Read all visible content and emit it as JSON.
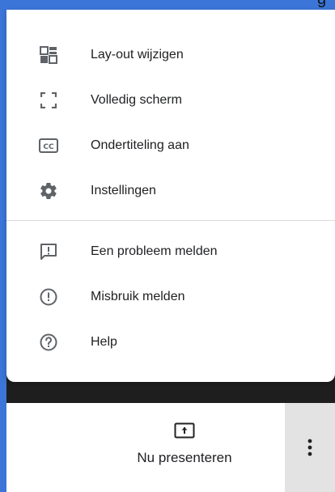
{
  "header": {
    "title_fragment": "g"
  },
  "menu": {
    "items": [
      {
        "label": "Lay-out wijzigen",
        "icon": "layout-icon"
      },
      {
        "label": "Volledig scherm",
        "icon": "fullscreen-icon"
      },
      {
        "label": "Ondertiteling aan",
        "icon": "closed-captions-icon"
      },
      {
        "label": "Instellingen",
        "icon": "gear-icon"
      },
      {
        "label": "Een probleem melden",
        "icon": "report-problem-icon"
      },
      {
        "label": "Misbruik melden",
        "icon": "report-abuse-icon"
      },
      {
        "label": "Help",
        "icon": "help-icon"
      }
    ]
  },
  "bottom_bar": {
    "present_label": "Nu presenteren",
    "present_icon": "present-screen-icon",
    "more_icon": "more-vert-icon"
  }
}
